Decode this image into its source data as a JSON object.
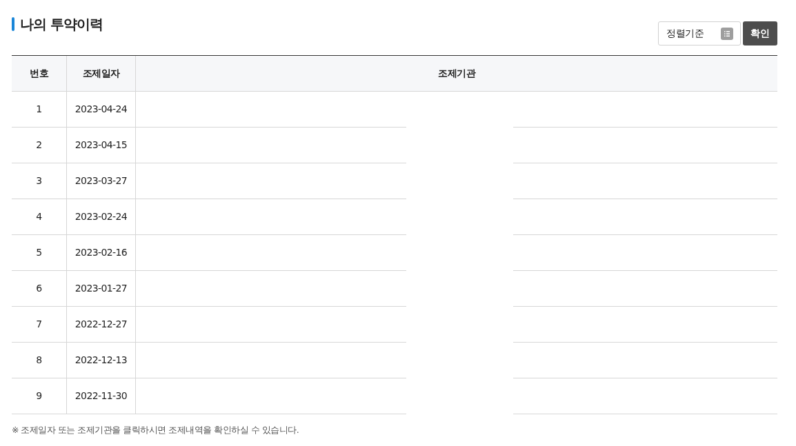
{
  "title": "나의 투약이력",
  "sort_select": {
    "value": "정렬기준"
  },
  "confirm_button": "확인",
  "table": {
    "columns": [
      "번호",
      "조제일자",
      "조제기관"
    ],
    "rows": [
      {
        "number": "1",
        "date": "2023-04-24"
      },
      {
        "number": "2",
        "date": "2023-04-15"
      },
      {
        "number": "3",
        "date": "2023-03-27"
      },
      {
        "number": "4",
        "date": "2023-02-24"
      },
      {
        "number": "5",
        "date": "2023-02-16"
      },
      {
        "number": "6",
        "date": "2023-01-27"
      },
      {
        "number": "7",
        "date": "2022-12-27"
      },
      {
        "number": "8",
        "date": "2022-12-13"
      },
      {
        "number": "9",
        "date": "2022-11-30"
      }
    ]
  },
  "note": "※ 조제일자 또는 조제기관을 클릭하시면 조제내역을 확인하실 수 있습니다."
}
